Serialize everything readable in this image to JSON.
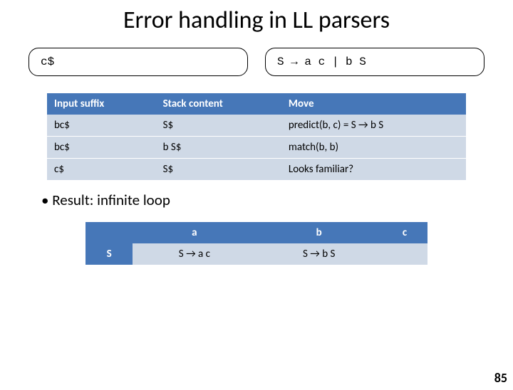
{
  "title": "Error handling in LL parsers",
  "input_pill": "c$",
  "grammar_pill": "S → a c | b S",
  "trace": {
    "headers": [
      "Input suffix",
      "Stack content",
      "Move"
    ],
    "rows": [
      [
        "bc$",
        "S$",
        "predict(b, c) = S → b S"
      ],
      [
        "bc$",
        "b S$",
        "match(b, b)"
      ],
      [
        "c$",
        "S$",
        "Looks familiar?"
      ]
    ]
  },
  "bullet": "•  Result: infinite loop",
  "predict": {
    "cols": [
      "a",
      "b",
      "c"
    ],
    "row_head": "S",
    "cells": [
      "S → a c",
      "S → b S",
      ""
    ]
  },
  "page_number": "85"
}
